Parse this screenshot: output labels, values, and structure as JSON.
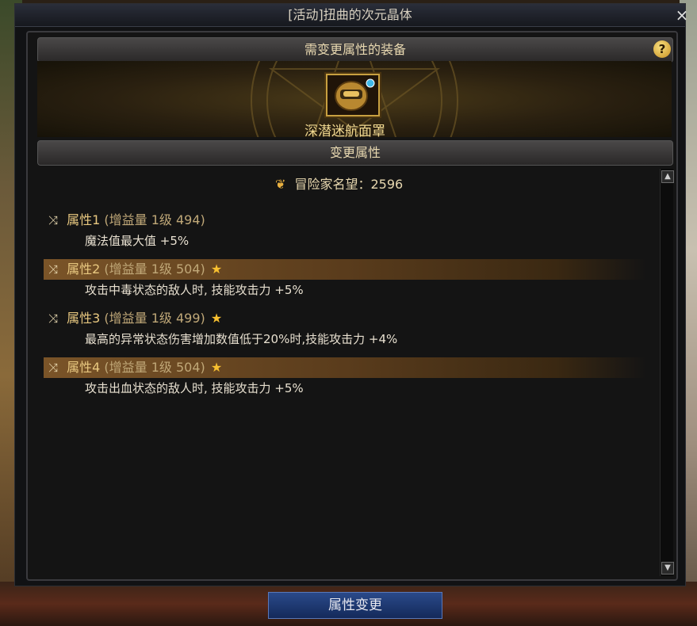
{
  "window": {
    "title": "[活动]扭曲的次元晶体",
    "close_label": "×"
  },
  "equip_section": {
    "header": "需变更属性的装备",
    "help_label": "?",
    "item_name": "深潜迷航面罩"
  },
  "change_section": {
    "header": "变更属性",
    "reputation_label": "冒险家名望：2596"
  },
  "attributes": [
    {
      "name": "属性1",
      "meta": "(增益量 1级 494)",
      "star": "",
      "desc": "魔法值最大值 +5%",
      "highlighted": false
    },
    {
      "name": "属性2",
      "meta": "(增益量 1级 504)",
      "star": "★",
      "desc": "攻击中毒状态的敌人时, 技能攻击力 +5%",
      "highlighted": true
    },
    {
      "name": "属性3",
      "meta": "(增益量 1级 499)",
      "star": "★",
      "desc": "最高的异常状态伤害增加数值低于20%时,技能攻击力 +4%",
      "highlighted": false
    },
    {
      "name": "属性4",
      "meta": "(增益量 1级 504)",
      "star": "★",
      "desc": "攻击出血状态的敌人时, 技能攻击力 +5%",
      "highlighted": true
    }
  ],
  "icons": {
    "shuffle": "⤨",
    "reputation": "reputation-icon",
    "scroll_up": "▲",
    "scroll_down": "▼"
  },
  "colors": {
    "accent_gold": "#e8c880",
    "highlight": "#7a5428",
    "button_blue": "#1e3a72"
  },
  "action_button": "属性变更"
}
